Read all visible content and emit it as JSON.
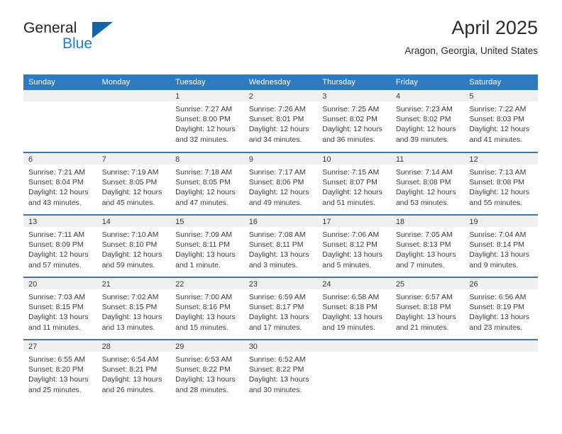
{
  "brand": {
    "name_part1": "General",
    "name_part2": "Blue",
    "logo_icon": "triangle-logo"
  },
  "header": {
    "month_title": "April 2025",
    "location": "Aragon, Georgia, United States"
  },
  "colors": {
    "header_blue": "#2f7bc0",
    "brand_blue": "#1a7fd4",
    "logo_blue": "#1464a8",
    "daynum_band": "#efefef",
    "text": "#3a3a3a"
  },
  "weekdays": [
    "Sunday",
    "Monday",
    "Tuesday",
    "Wednesday",
    "Thursday",
    "Friday",
    "Saturday"
  ],
  "weeks": [
    [
      {
        "day": "",
        "empty": true
      },
      {
        "day": "",
        "empty": true
      },
      {
        "day": "1",
        "sunrise": "Sunrise: 7:27 AM",
        "sunset": "Sunset: 8:00 PM",
        "daylight_line1": "Daylight: 12 hours",
        "daylight_line2": "and 32 minutes."
      },
      {
        "day": "2",
        "sunrise": "Sunrise: 7:26 AM",
        "sunset": "Sunset: 8:01 PM",
        "daylight_line1": "Daylight: 12 hours",
        "daylight_line2": "and 34 minutes."
      },
      {
        "day": "3",
        "sunrise": "Sunrise: 7:25 AM",
        "sunset": "Sunset: 8:02 PM",
        "daylight_line1": "Daylight: 12 hours",
        "daylight_line2": "and 36 minutes."
      },
      {
        "day": "4",
        "sunrise": "Sunrise: 7:23 AM",
        "sunset": "Sunset: 8:02 PM",
        "daylight_line1": "Daylight: 12 hours",
        "daylight_line2": "and 39 minutes."
      },
      {
        "day": "5",
        "sunrise": "Sunrise: 7:22 AM",
        "sunset": "Sunset: 8:03 PM",
        "daylight_line1": "Daylight: 12 hours",
        "daylight_line2": "and 41 minutes."
      }
    ],
    [
      {
        "day": "6",
        "sunrise": "Sunrise: 7:21 AM",
        "sunset": "Sunset: 8:04 PM",
        "daylight_line1": "Daylight: 12 hours",
        "daylight_line2": "and 43 minutes."
      },
      {
        "day": "7",
        "sunrise": "Sunrise: 7:19 AM",
        "sunset": "Sunset: 8:05 PM",
        "daylight_line1": "Daylight: 12 hours",
        "daylight_line2": "and 45 minutes."
      },
      {
        "day": "8",
        "sunrise": "Sunrise: 7:18 AM",
        "sunset": "Sunset: 8:05 PM",
        "daylight_line1": "Daylight: 12 hours",
        "daylight_line2": "and 47 minutes."
      },
      {
        "day": "9",
        "sunrise": "Sunrise: 7:17 AM",
        "sunset": "Sunset: 8:06 PM",
        "daylight_line1": "Daylight: 12 hours",
        "daylight_line2": "and 49 minutes."
      },
      {
        "day": "10",
        "sunrise": "Sunrise: 7:15 AM",
        "sunset": "Sunset: 8:07 PM",
        "daylight_line1": "Daylight: 12 hours",
        "daylight_line2": "and 51 minutes."
      },
      {
        "day": "11",
        "sunrise": "Sunrise: 7:14 AM",
        "sunset": "Sunset: 8:08 PM",
        "daylight_line1": "Daylight: 12 hours",
        "daylight_line2": "and 53 minutes."
      },
      {
        "day": "12",
        "sunrise": "Sunrise: 7:13 AM",
        "sunset": "Sunset: 8:08 PM",
        "daylight_line1": "Daylight: 12 hours",
        "daylight_line2": "and 55 minutes."
      }
    ],
    [
      {
        "day": "13",
        "sunrise": "Sunrise: 7:11 AM",
        "sunset": "Sunset: 8:09 PM",
        "daylight_line1": "Daylight: 12 hours",
        "daylight_line2": "and 57 minutes."
      },
      {
        "day": "14",
        "sunrise": "Sunrise: 7:10 AM",
        "sunset": "Sunset: 8:10 PM",
        "daylight_line1": "Daylight: 12 hours",
        "daylight_line2": "and 59 minutes."
      },
      {
        "day": "15",
        "sunrise": "Sunrise: 7:09 AM",
        "sunset": "Sunset: 8:11 PM",
        "daylight_line1": "Daylight: 13 hours",
        "daylight_line2": "and 1 minute."
      },
      {
        "day": "16",
        "sunrise": "Sunrise: 7:08 AM",
        "sunset": "Sunset: 8:11 PM",
        "daylight_line1": "Daylight: 13 hours",
        "daylight_line2": "and 3 minutes."
      },
      {
        "day": "17",
        "sunrise": "Sunrise: 7:06 AM",
        "sunset": "Sunset: 8:12 PM",
        "daylight_line1": "Daylight: 13 hours",
        "daylight_line2": "and 5 minutes."
      },
      {
        "day": "18",
        "sunrise": "Sunrise: 7:05 AM",
        "sunset": "Sunset: 8:13 PM",
        "daylight_line1": "Daylight: 13 hours",
        "daylight_line2": "and 7 minutes."
      },
      {
        "day": "19",
        "sunrise": "Sunrise: 7:04 AM",
        "sunset": "Sunset: 8:14 PM",
        "daylight_line1": "Daylight: 13 hours",
        "daylight_line2": "and 9 minutes."
      }
    ],
    [
      {
        "day": "20",
        "sunrise": "Sunrise: 7:03 AM",
        "sunset": "Sunset: 8:15 PM",
        "daylight_line1": "Daylight: 13 hours",
        "daylight_line2": "and 11 minutes."
      },
      {
        "day": "21",
        "sunrise": "Sunrise: 7:02 AM",
        "sunset": "Sunset: 8:15 PM",
        "daylight_line1": "Daylight: 13 hours",
        "daylight_line2": "and 13 minutes."
      },
      {
        "day": "22",
        "sunrise": "Sunrise: 7:00 AM",
        "sunset": "Sunset: 8:16 PM",
        "daylight_line1": "Daylight: 13 hours",
        "daylight_line2": "and 15 minutes."
      },
      {
        "day": "23",
        "sunrise": "Sunrise: 6:59 AM",
        "sunset": "Sunset: 8:17 PM",
        "daylight_line1": "Daylight: 13 hours",
        "daylight_line2": "and 17 minutes."
      },
      {
        "day": "24",
        "sunrise": "Sunrise: 6:58 AM",
        "sunset": "Sunset: 8:18 PM",
        "daylight_line1": "Daylight: 13 hours",
        "daylight_line2": "and 19 minutes."
      },
      {
        "day": "25",
        "sunrise": "Sunrise: 6:57 AM",
        "sunset": "Sunset: 8:18 PM",
        "daylight_line1": "Daylight: 13 hours",
        "daylight_line2": "and 21 minutes."
      },
      {
        "day": "26",
        "sunrise": "Sunrise: 6:56 AM",
        "sunset": "Sunset: 8:19 PM",
        "daylight_line1": "Daylight: 13 hours",
        "daylight_line2": "and 23 minutes."
      }
    ],
    [
      {
        "day": "27",
        "sunrise": "Sunrise: 6:55 AM",
        "sunset": "Sunset: 8:20 PM",
        "daylight_line1": "Daylight: 13 hours",
        "daylight_line2": "and 25 minutes."
      },
      {
        "day": "28",
        "sunrise": "Sunrise: 6:54 AM",
        "sunset": "Sunset: 8:21 PM",
        "daylight_line1": "Daylight: 13 hours",
        "daylight_line2": "and 26 minutes."
      },
      {
        "day": "29",
        "sunrise": "Sunrise: 6:53 AM",
        "sunset": "Sunset: 8:22 PM",
        "daylight_line1": "Daylight: 13 hours",
        "daylight_line2": "and 28 minutes."
      },
      {
        "day": "30",
        "sunrise": "Sunrise: 6:52 AM",
        "sunset": "Sunset: 8:22 PM",
        "daylight_line1": "Daylight: 13 hours",
        "daylight_line2": "and 30 minutes."
      },
      {
        "day": "",
        "empty": true
      },
      {
        "day": "",
        "empty": true
      },
      {
        "day": "",
        "empty": true
      }
    ]
  ]
}
